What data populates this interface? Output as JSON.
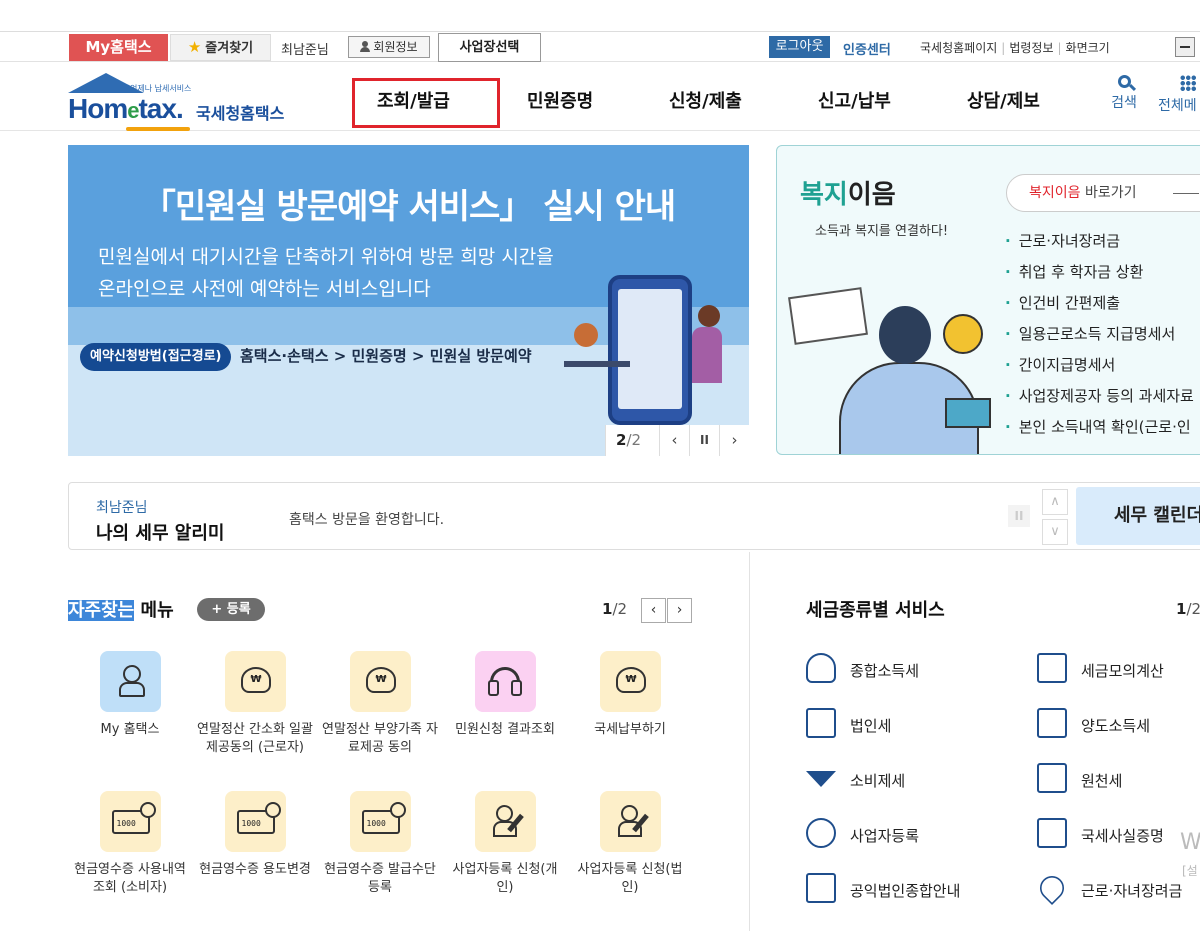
{
  "topbar": {
    "my_hometax": "My홈택스",
    "favorites": "즐겨찾기",
    "user_name": "최남준님",
    "member_info": "회원정보",
    "business_select": "사업장선택",
    "logout": "로그아웃",
    "cert_center": "인증센터",
    "links": [
      "국세청홈페이지",
      "법령정보",
      "화면크기"
    ]
  },
  "header": {
    "logo_small": "언제나 납세서비스",
    "logo_brand_a": "Hom",
    "logo_brand_e": "e",
    "logo_brand_b": "tax.",
    "logo_kr": "국세청홈택스",
    "nav": [
      "조회/발급",
      "민원증명",
      "신청/제출",
      "신고/납부",
      "상담/제보"
    ],
    "active_nav": "조회/발급",
    "search": "검색",
    "all_menu": "전체메"
  },
  "banner": {
    "title": "「민원실 방문예약 서비스」 실시 안내",
    "desc_line1": "민원실에서 대기시간을 단축하기 위하여 방문 희망 시간을",
    "desc_line2": "온라인으로 사전에 예약하는 서비스입니다",
    "method_pill": "예약신청방법(접근경로)",
    "route": "홈택스·손택스 > 민원증명 > 민원실 방문예약",
    "page_current": "2",
    "page_total": "/2",
    "prev": "‹",
    "pause": "II",
    "next": "›"
  },
  "welfare": {
    "title_a": "복지",
    "title_b": "이음",
    "subtitle": "소득과 복지를 연결하다!",
    "go_red": "복지이음",
    "go_rest": " 바로가기",
    "items": [
      "근로·자녀장려금",
      "취업 후 학자금 상환",
      "인건비 간편제출",
      "일용근로소득 지급명세서",
      "간이지급명세서",
      "사업장제공자 등의 과세자료",
      "본인 소득내역 확인(근로·인"
    ]
  },
  "alert": {
    "name": "최남준님",
    "label": "나의 세무 알리미",
    "message": "홈택스 방문을 환영합니다.",
    "pause": "II",
    "up": "∧",
    "down": "∨",
    "calendar": "세무 캘린더"
  },
  "frequent": {
    "title_hl": "자주찾는",
    "title_rest": " 메뉴",
    "register": "+ 등록",
    "page_current": "1",
    "page_total": "/2",
    "prev": "‹",
    "next": "›",
    "tiles": [
      {
        "label": "My 홈택스",
        "icon": "user-icon",
        "color": "#bfdff8"
      },
      {
        "label": "연말정산 간소화 일괄제공동의 (근로자)",
        "icon": "money-bag-icon",
        "color": "#fdefc9"
      },
      {
        "label": "연말정산 부양가족 자료제공 동의",
        "icon": "money-bag-icon",
        "color": "#fdefc9"
      },
      {
        "label": "민원신청 결과조회",
        "icon": "headset-icon",
        "color": "#fbd1f2"
      },
      {
        "label": "국세납부하기",
        "icon": "money-bag-icon",
        "color": "#fdefc9"
      },
      {
        "label": "현금영수증 사용내역조회 (소비자)",
        "icon": "cash-receipt-icon",
        "color": "#fdefc9"
      },
      {
        "label": "현금영수증 용도변경",
        "icon": "cash-receipt-icon",
        "color": "#fdefc9"
      },
      {
        "label": "현금영수증 발급수단 등록",
        "icon": "cash-receipt-icon",
        "color": "#fdefc9"
      },
      {
        "label": "사업자등록 신청(개인)",
        "icon": "user-pen-icon",
        "color": "#fdefc9"
      },
      {
        "label": "사업자등록 신청(법인)",
        "icon": "user-pen-icon",
        "color": "#fdefc9"
      }
    ]
  },
  "tax_service": {
    "title": "세금종류별 서비스",
    "page_current": "1",
    "page_total": "/2",
    "items": [
      {
        "label": "종합소득세",
        "icon": "money-bag-icon"
      },
      {
        "label": "세금모의계산",
        "icon": "calculator-icon"
      },
      {
        "label": "법인세",
        "icon": "building-icon"
      },
      {
        "label": "양도소득세",
        "icon": "document-pen-icon"
      },
      {
        "label": "소비제세",
        "icon": "gem-icon"
      },
      {
        "label": "원천세",
        "icon": "salary-slip-icon"
      },
      {
        "label": "사업자등록",
        "icon": "user-icon"
      },
      {
        "label": "국세사실증명",
        "icon": "certificate-icon"
      },
      {
        "label": "공익법인종합안내",
        "icon": "clipboard-icon"
      },
      {
        "label": "근로·자녀장려금",
        "icon": "heart-hands-icon"
      }
    ]
  },
  "watermark": {
    "line1": "W",
    "line2": "[설"
  }
}
